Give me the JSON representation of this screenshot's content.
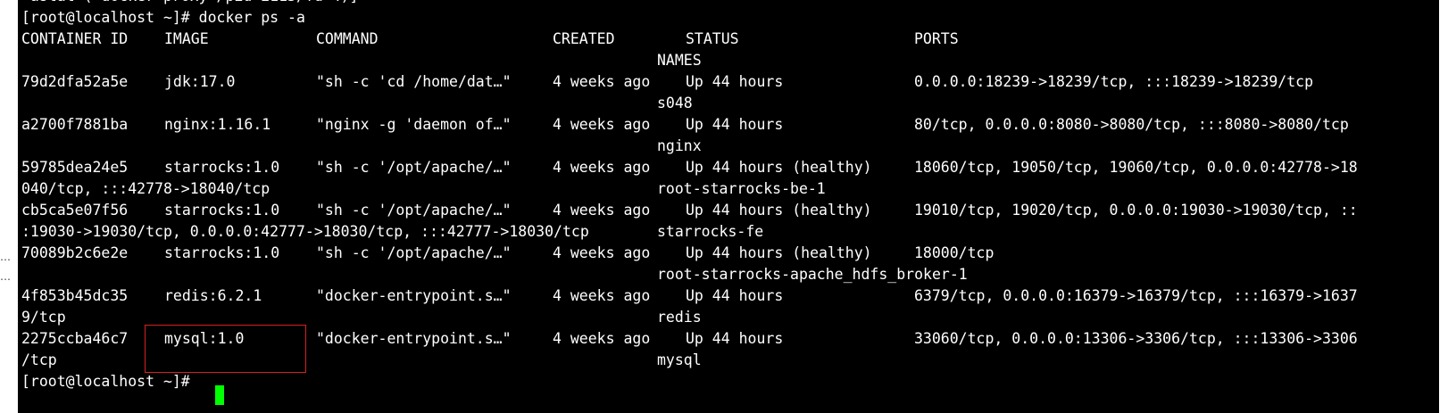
{
  "terminal": {
    "top_cut_text": "–astat ( docker-proxy /pid 2115/fd 4)]",
    "prompt_command": "[root@localhost ~]# docker ps -a",
    "headers": {
      "container_id": "CONTAINER ID",
      "image": "IMAGE",
      "command": "COMMAND",
      "created": "CREATED",
      "status": "STATUS",
      "ports": "PORTS",
      "names": "NAMES"
    },
    "rows": [
      {
        "id": "79d2dfa52a5e",
        "image": "jdk:17.0",
        "command": "\"sh -c 'cd /home/dat…\"",
        "created": "4 weeks ago",
        "status": "Up 44 hours",
        "ports": "0.0.0.0:18239->18239/tcp, :::18239->18239/tcp",
        "ports_cont": "",
        "name": "s048"
      },
      {
        "id": "a2700f7881ba",
        "image": "nginx:1.16.1",
        "command": "\"nginx -g 'daemon of…\"",
        "created": "4 weeks ago",
        "status": "Up 44 hours",
        "ports": "80/tcp, 0.0.0.0:8080->8080/tcp, :::8080->8080/tcp",
        "ports_cont": "",
        "name": "nginx"
      },
      {
        "id": "59785dea24e5",
        "image": "starrocks:1.0",
        "command": "\"sh -c '/opt/apache/…\"",
        "created": "4 weeks ago",
        "status": "Up 44 hours (healthy)",
        "ports": "18060/tcp, 19050/tcp, 19060/tcp, 0.0.0.0:42778->18",
        "ports_cont": "040/tcp, :::42778->18040/tcp",
        "name": "root-starrocks-be-1"
      },
      {
        "id": "cb5ca5e07f56",
        "image": "starrocks:1.0",
        "command": "\"sh -c '/opt/apache/…\"",
        "created": "4 weeks ago",
        "status": "Up 44 hours (healthy)",
        "ports": "19010/tcp, 19020/tcp, 0.0.0.0:19030->19030/tcp, ::",
        "ports_cont": ":19030->19030/tcp, 0.0.0.0:42777->18030/tcp, :::42777->18030/tcp",
        "name": "starrocks-fe"
      },
      {
        "id": "70089b2c6e2e",
        "image": "starrocks:1.0",
        "command": "\"sh -c '/opt/apache/…\"",
        "created": "4 weeks ago",
        "status": "Up 44 hours (healthy)",
        "ports": "18000/tcp",
        "ports_cont": "",
        "name": "root-starrocks-apache_hdfs_broker-1"
      },
      {
        "id": "4f853b45dc35",
        "image": "redis:6.2.1",
        "command": "\"docker-entrypoint.s…\"",
        "created": "4 weeks ago",
        "status": "Up 44 hours",
        "ports": "6379/tcp, 0.0.0.0:16379->16379/tcp, :::16379->1637",
        "ports_cont": "9/tcp",
        "name": "redis"
      },
      {
        "id": "2275ccba46c7",
        "image": "mysql:1.0",
        "command": "\"docker-entrypoint.s…\"",
        "created": "4 weeks ago",
        "status": "Up 44 hours",
        "ports": "33060/tcp, 0.0.0.0:13306->3306/tcp, :::13306->3306",
        "ports_cont": "/tcp",
        "name": "mysql"
      }
    ],
    "final_prompt": "[root@localhost ~]#"
  },
  "side_marks": {
    "dot_1": "…",
    "dot_2": "…"
  },
  "colors": {
    "background": "#000000",
    "text": "#ffffff",
    "cursor": "#00ff00",
    "highlight_border": "#d92020"
  }
}
